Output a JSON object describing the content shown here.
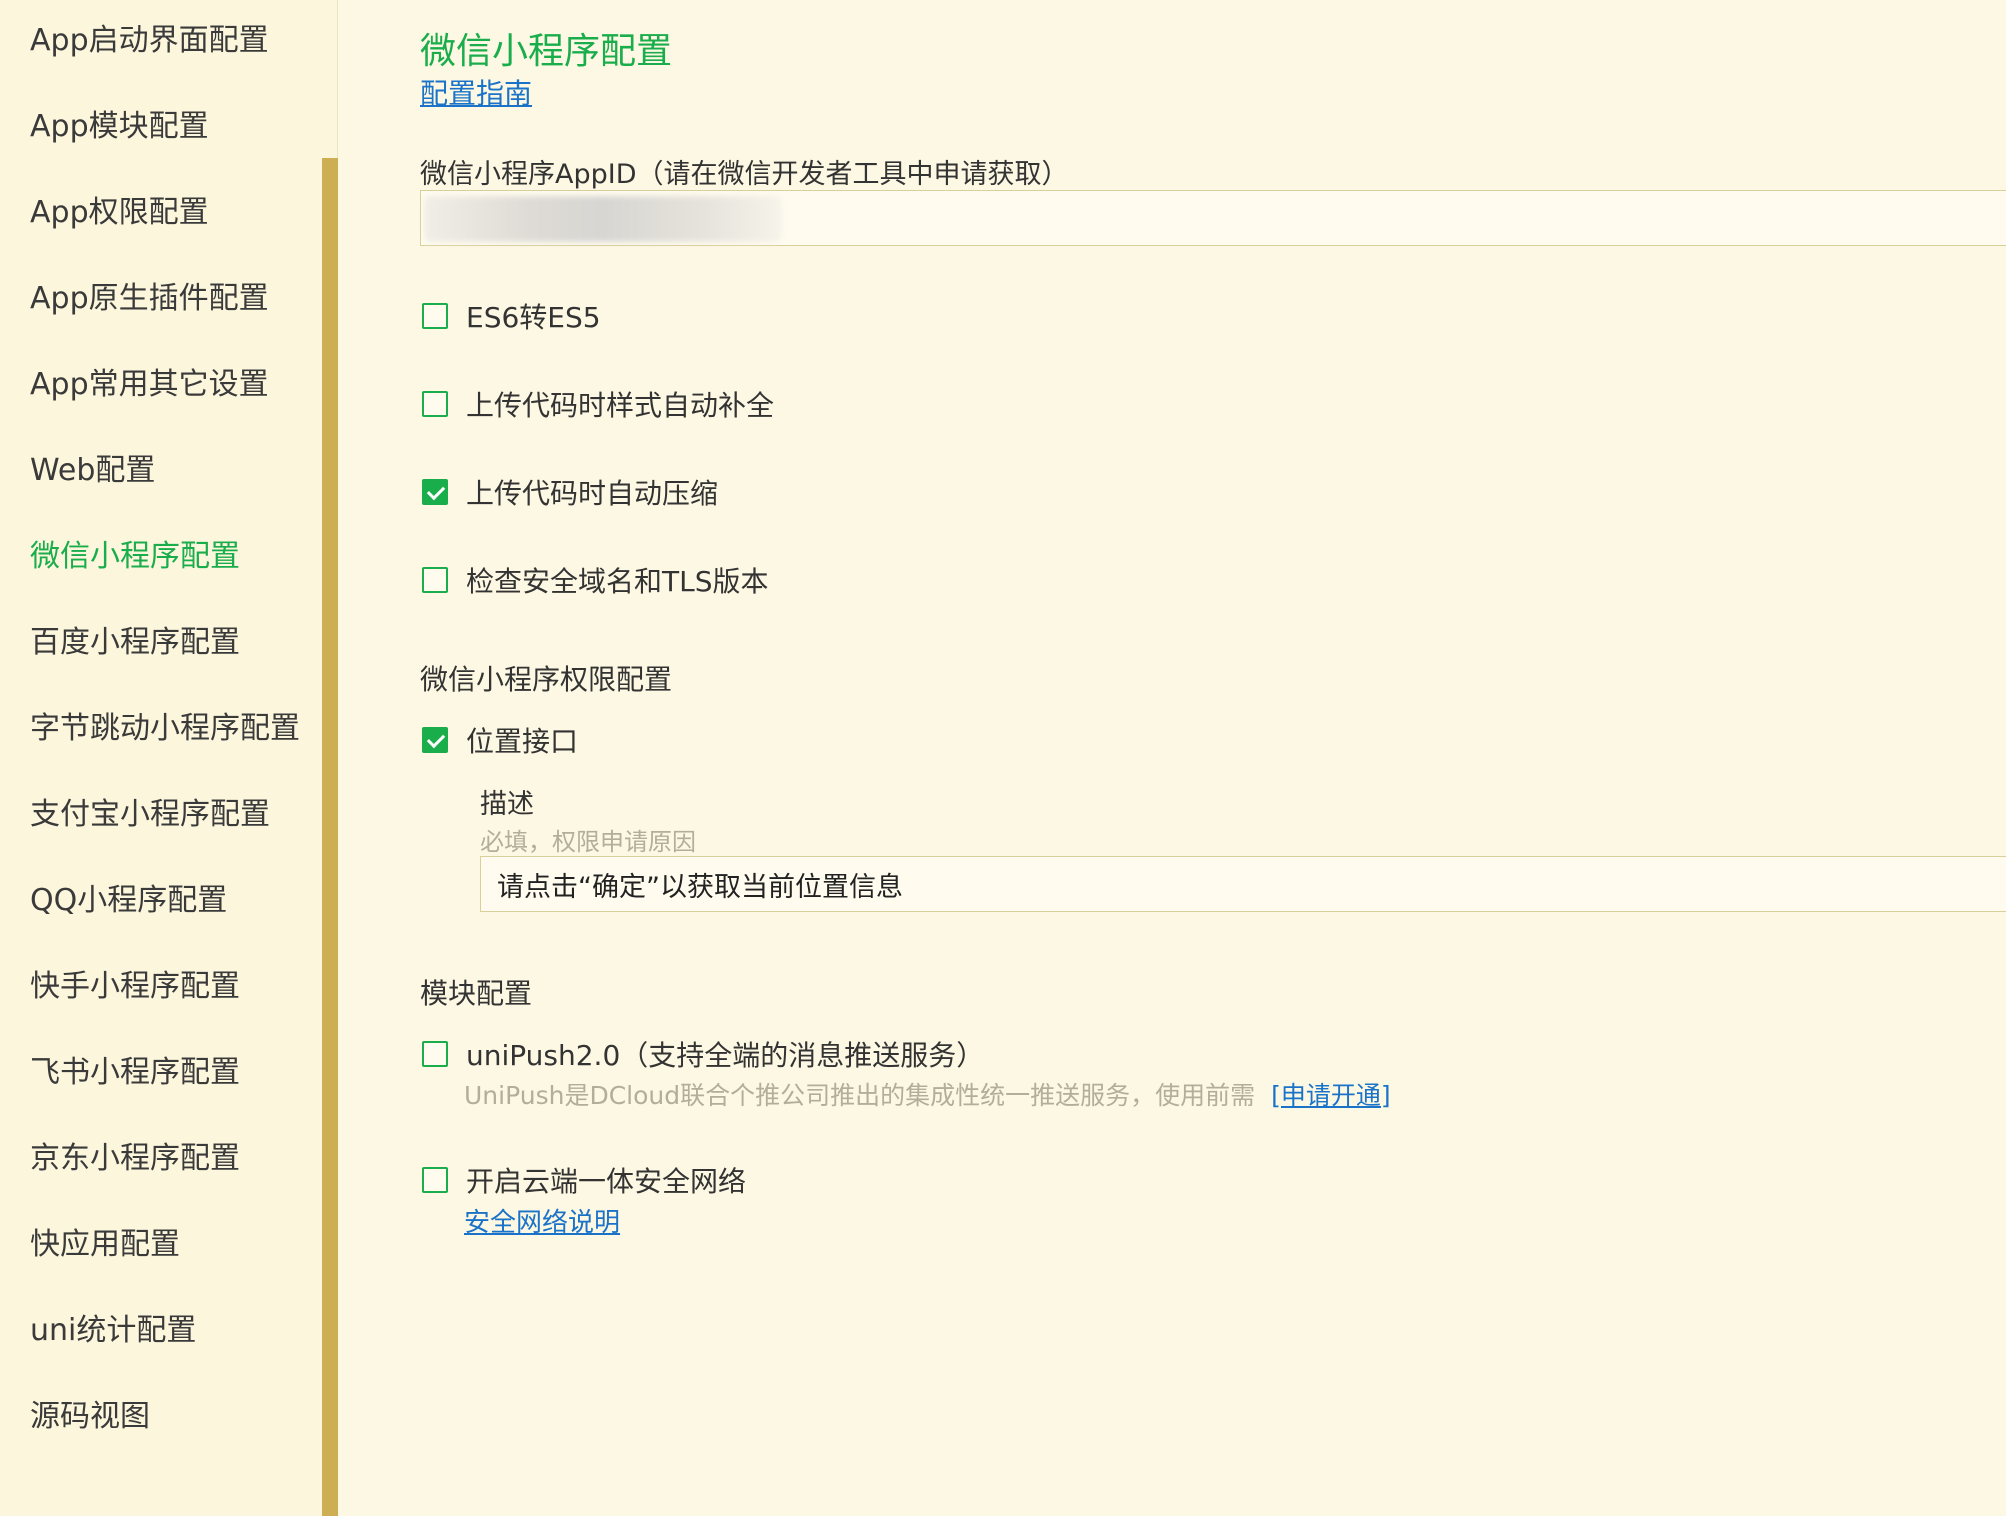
{
  "sidebar": {
    "items": [
      {
        "label": "App启动界面配置",
        "active": false
      },
      {
        "label": "App模块配置",
        "active": false
      },
      {
        "label": "App权限配置",
        "active": false
      },
      {
        "label": "App原生插件配置",
        "active": false
      },
      {
        "label": "App常用其它设置",
        "active": false
      },
      {
        "label": "Web配置",
        "active": false
      },
      {
        "label": "微信小程序配置",
        "active": true
      },
      {
        "label": "百度小程序配置",
        "active": false
      },
      {
        "label": "字节跳动小程序配置",
        "active": false
      },
      {
        "label": "支付宝小程序配置",
        "active": false
      },
      {
        "label": "QQ小程序配置",
        "active": false
      },
      {
        "label": "快手小程序配置",
        "active": false
      },
      {
        "label": "飞书小程序配置",
        "active": false
      },
      {
        "label": "京东小程序配置",
        "active": false
      },
      {
        "label": "快应用配置",
        "active": false
      },
      {
        "label": "uni统计配置",
        "active": false
      },
      {
        "label": "源码视图",
        "active": false
      }
    ]
  },
  "main": {
    "title": "微信小程序配置",
    "guide_link": "配置指南",
    "appid": {
      "label": "微信小程序AppID（请在微信开发者工具中申请获取）",
      "value": ""
    },
    "options": [
      {
        "label": "ES6转ES5",
        "checked": false
      },
      {
        "label": "上传代码时样式自动补全",
        "checked": false
      },
      {
        "label": "上传代码时自动压缩",
        "checked": true
      },
      {
        "label": "检查安全域名和TLS版本",
        "checked": false
      }
    ],
    "permissions": {
      "title": "微信小程序权限配置",
      "location": {
        "label": "位置接口",
        "checked": true
      },
      "desc_label": "描述",
      "desc_hint": "必填，权限申请原因",
      "desc_value": "请点击“确定”以获取当前位置信息"
    },
    "modules": {
      "title": "模块配置",
      "unipush": {
        "label": "uniPush2.0（支持全端的消息推送服务）",
        "checked": false,
        "hint": "UniPush是DCloud联合个推公司推出的集成性统一推送服务，使用前需",
        "apply_link": "[申请开通]"
      },
      "secure_network": {
        "label": "开启云端一体安全网络",
        "checked": false,
        "link": "安全网络说明"
      }
    }
  },
  "colors": {
    "accent": "#1aad4b",
    "link": "#1a73c8",
    "background": "#fdf8e3",
    "scrollbar": "#cdae52"
  }
}
